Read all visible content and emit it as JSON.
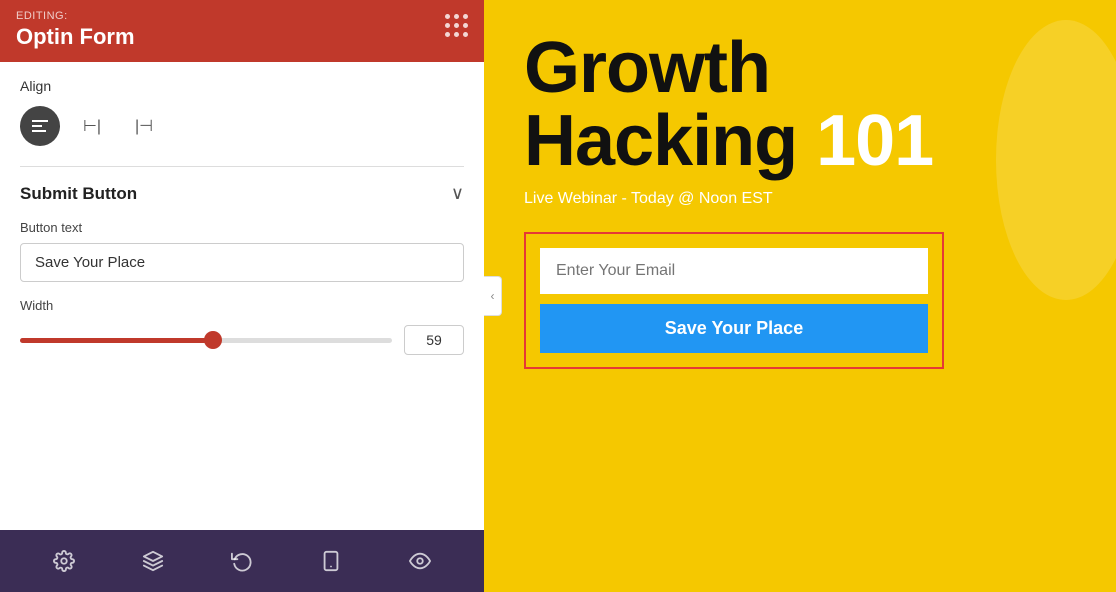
{
  "header": {
    "editing_label": "EDITING:",
    "title": "Optin Form"
  },
  "align_section": {
    "label": "Align",
    "buttons": [
      {
        "id": "align-left",
        "symbol": "⊣",
        "active": true
      },
      {
        "id": "align-center",
        "symbol": "⊢",
        "active": false
      },
      {
        "id": "align-right",
        "symbol": "⊣",
        "active": false
      }
    ]
  },
  "submit_button_section": {
    "title": "Submit Button",
    "button_text_label": "Button text",
    "button_text_value": "Save Your Place",
    "width_label": "Width",
    "width_value": "59"
  },
  "toolbar": {
    "icons": [
      "gear",
      "layers",
      "history",
      "mobile",
      "eye"
    ]
  },
  "right_panel": {
    "heading_line1": "Growth",
    "heading_line2_part1": "Hacking ",
    "heading_line2_part2": "101",
    "subheading": "Live Webinar - Today @ Noon EST",
    "email_placeholder": "Enter Your Email",
    "submit_button_label": "Save Your Place"
  }
}
